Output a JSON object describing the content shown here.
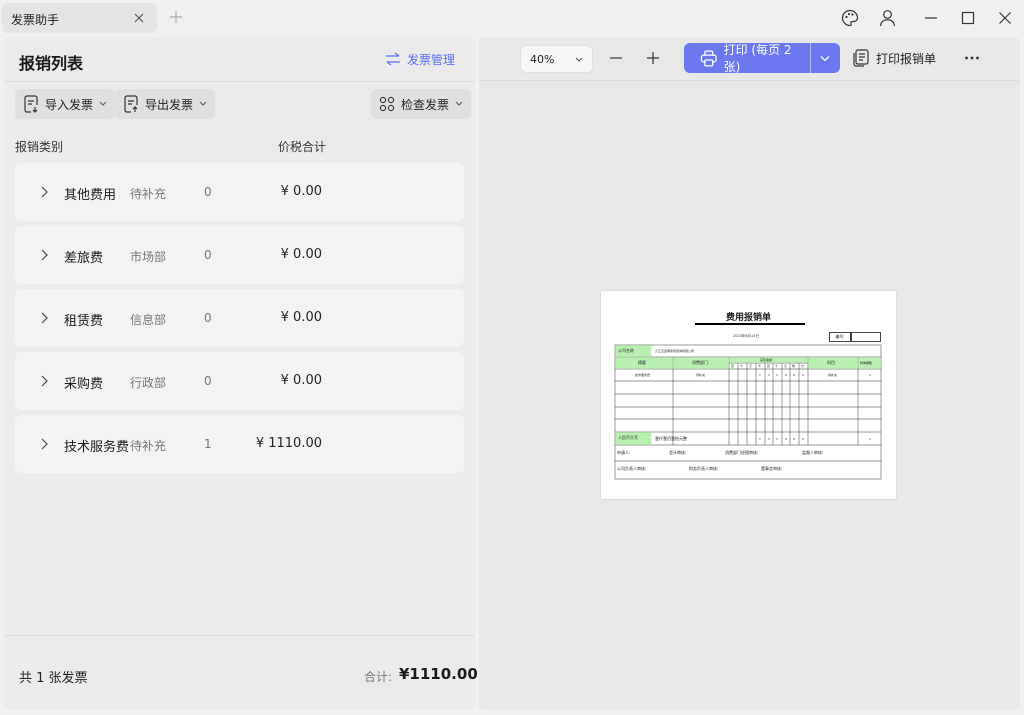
{
  "tab": {
    "title": "发票助手"
  },
  "window": {
    "icons": [
      "palette-icon",
      "user-icon",
      "minimize-icon",
      "maximize-icon",
      "close-icon"
    ]
  },
  "left": {
    "title": "报销列表",
    "manage_label": "发票管理",
    "import_label": "导入发票",
    "export_label": "导出发票",
    "check_label": "检查发票",
    "col_category": "报销类别",
    "col_amount": "价税合计",
    "rows": [
      {
        "category": "其他费用",
        "dept": "待补充",
        "count": "0",
        "amount": "¥ 0.00"
      },
      {
        "category": "差旅费",
        "dept": "市场部",
        "count": "0",
        "amount": "¥ 0.00"
      },
      {
        "category": "租赁费",
        "dept": "信息部",
        "count": "0",
        "amount": "¥ 0.00"
      },
      {
        "category": "采购费",
        "dept": "行政部",
        "count": "0",
        "amount": "¥ 0.00"
      },
      {
        "category": "技术服务费",
        "dept": "待补充",
        "count": "1",
        "amount": "¥ 1110.00"
      }
    ],
    "footer_count": "共 1 张发票",
    "footer_total_label": "合计:",
    "footer_total": "¥1110.00"
  },
  "right": {
    "zoom": "40%",
    "print_label": "打印 (每页 2 张)",
    "print_report_label": "打印报销单",
    "accent": "#6b78ef"
  },
  "sheet": {
    "title": "费用报销单",
    "date": "2024年6月14日",
    "no_label": "编号:",
    "company_label": "公司名称",
    "company": "九江互连网家用咨询有限公司",
    "h_summary": "摘要",
    "h_dept": "消费部门",
    "h_amount": "实际金额",
    "h_subject": "科目",
    "h_attach": "附单据数",
    "digits": [
      "百",
      "十",
      "万",
      "千",
      "百",
      "十",
      "元",
      "角",
      "分"
    ],
    "r1_summary": "技术服务费",
    "r1_dept": "待补充",
    "r1_subject": "待补充",
    "r1_attach": "1",
    "r1_digits": [
      "",
      "",
      "",
      "1",
      "1",
      "1",
      "0",
      "0",
      "0"
    ],
    "total_label": "人民币大写",
    "total_words": "壹仟壹佰壹拾元整",
    "total_attach": "1",
    "applicant": "申请人:",
    "accountant": "会计审核:",
    "dept_manager": "消费部门经理审核:",
    "supervisor": "监督人审核:",
    "company_head": "公司负责人审核:",
    "finance_head": "财务负责人审核:",
    "chairman": "董事会审核:"
  }
}
